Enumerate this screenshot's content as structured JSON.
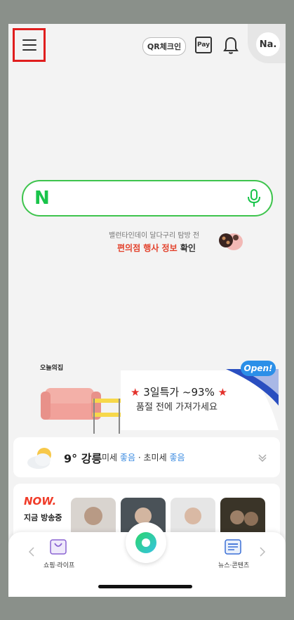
{
  "header": {
    "qr_label": "QR체크인",
    "pay_label": "Pay",
    "avatar_label": "Na."
  },
  "search": {
    "logo": "N"
  },
  "promo": {
    "line1": "밸런타인데이 달다구리 탐방 전",
    "line2_highlight": "편의점 행사 정보",
    "line2_rest": " 확인"
  },
  "ad": {
    "brand": "오늘의집",
    "headline_star_left": "★",
    "headline": " 3일특가 ~93% ",
    "headline_star_right": "★",
    "subline": "품절 전에 가져가세요",
    "badge": "Open!"
  },
  "weather": {
    "temp": "9°",
    "city": "강릉",
    "fine_dust_label": "미세",
    "fine_dust_value": "좋음",
    "separator": "·",
    "ultrafine_label": "초미세",
    "ultrafine_value": "좋음"
  },
  "now": {
    "logo": "NOW.",
    "subtitle": "지금 방송중"
  },
  "bottom_bar": {
    "shopping_label": "쇼핑·라이프",
    "news_label": "뉴스·콘텐츠"
  },
  "colors": {
    "accent_green": "#19c44a",
    "highlight_red": "#e3412b",
    "good_blue": "#3b8be0"
  }
}
